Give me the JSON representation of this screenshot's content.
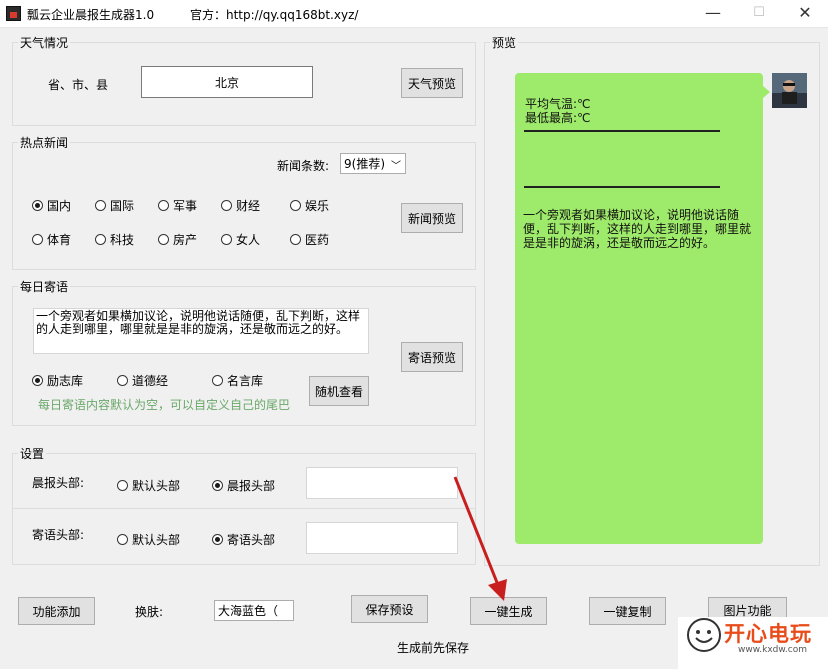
{
  "window": {
    "title": "瓢云企业晨报生成器1.0",
    "official": "官方：http://qy.qq168bt.xyz/",
    "minimize": "—",
    "maximize": "☐",
    "close": "✕"
  },
  "weather": {
    "group_title": "天气情况",
    "location_label": "省、市、县",
    "location_value": "北京",
    "preview_button": "天气预览"
  },
  "news": {
    "group_title": "热点新闻",
    "count_label": "新闻条数:",
    "count_value": "9(推荐)",
    "categories": [
      {
        "label": "国内",
        "checked": true
      },
      {
        "label": "国际",
        "checked": false
      },
      {
        "label": "军事",
        "checked": false
      },
      {
        "label": "财经",
        "checked": false
      },
      {
        "label": "娱乐",
        "checked": false
      },
      {
        "label": "体育",
        "checked": false
      },
      {
        "label": "科技",
        "checked": false
      },
      {
        "label": "房产",
        "checked": false
      },
      {
        "label": "女人",
        "checked": false
      },
      {
        "label": "医药",
        "checked": false
      }
    ],
    "preview_button": "新闻预览"
  },
  "quote": {
    "group_title": "每日寄语",
    "text": "一个旁观者如果横加议论，说明他说话随便，乱下判断，这样的人走到哪里，哪里就是是非的旋涡，还是敬而远之的好。",
    "preview_button": "寄语预览",
    "libraries": [
      {
        "label": "励志库",
        "checked": true
      },
      {
        "label": "道德经",
        "checked": false
      },
      {
        "label": "名言库",
        "checked": false
      }
    ],
    "random_button": "随机查看",
    "hint": "每日寄语内容默认为空，可以自定义自己的尾巴",
    "hint_color": "#6aa86a"
  },
  "settings": {
    "group_title": "设置",
    "morning_header_label": "晨报头部:",
    "morning_options": [
      {
        "label": "默认头部",
        "checked": false
      },
      {
        "label": "晨报头部",
        "checked": true
      }
    ],
    "quote_header_label": "寄语头部:",
    "quote_options": [
      {
        "label": "默认头部",
        "checked": false
      },
      {
        "label": "寄语头部",
        "checked": true
      }
    ]
  },
  "preview": {
    "group_title": "预览",
    "avg_temp": "平均气温:℃",
    "min_max": "最低最高:℃",
    "quote": "一个旁观者如果横加议论，说明他说话随便，乱下判断，这样的人走到哪里，哪里就是是非的旋涡，还是敬而远之的好。",
    "bubble_color": "#9eea6a"
  },
  "footer": {
    "add_feature_button": "功能添加",
    "skin_label": "换肤:",
    "skin_value": "大海蓝色（",
    "save_preset_button": "保存预设",
    "generate_button": "一键生成",
    "copy_button": "一键复制",
    "image_button": "图片功能",
    "save_hint": "生成前先保存"
  },
  "watermark": {
    "text": "开心电玩",
    "url": "www.kxdw.com"
  }
}
